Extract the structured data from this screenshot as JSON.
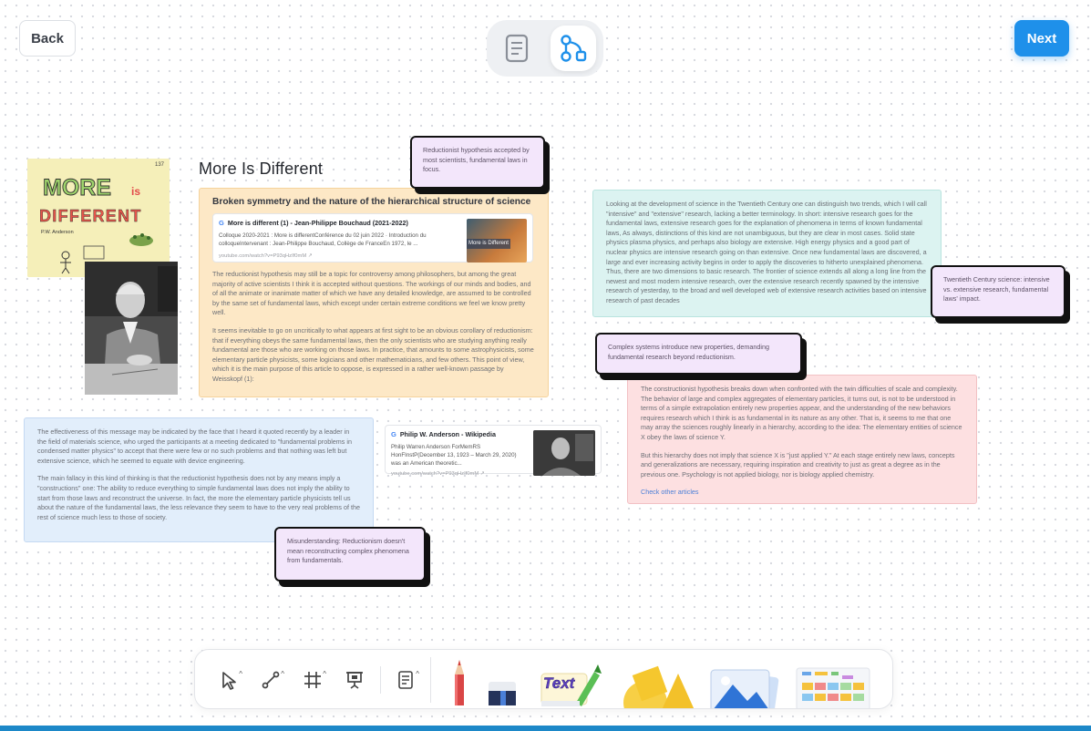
{
  "header": {
    "back_label": "Back",
    "next_label": "Next"
  },
  "page": {
    "title": "More Is Different"
  },
  "poster": {
    "line1": "MORE",
    "line1b": "is",
    "line2": "DIFFERENT",
    "author": "P.W. Anderson",
    "corner": "137"
  },
  "card_orange": {
    "heading": "Broken symmetry and the nature of the hierarchical structure of science",
    "link": {
      "title": "More is different (1) - Jean-Philippe Bouchaud (2021-2022)",
      "desc": "Colloque 2020-2021 : More is differentConférence du 02 juin 2022 · Introduction du colloqueIntervenant : Jean-Philippe Bouchaud, Collège de FranceEn 1972, le ...",
      "url": "youtube.com/watch?v=P93qHzIf0mM",
      "thumb_caption": "More is Different"
    },
    "p1": "The reductionist hypothesis may still be a topic for controversy among philosophers, but among the great majority of active scientists I think it is accepted without questions. The workings of our minds and bodies, and of all the animate or inanimate matter of which we have any detailed knowledge, are assumed to be controlled by the same set of fundamental laws, which except under certain extreme conditions we feel we know pretty well.",
    "p2": "It seems inevitable to go on uncritically to what appears at first sight to be an obvious corollary of reductionism: that if everything obeys the same fundamental laws, then the only scientists who are studying anything really fundamental are those who are working on those laws. In practice, that amounts to some astrophysicists, some elementary particle physicists, some logicians and other mathematicians, and few others. This point of view, which it is the main purpose of this article to oppose, is expressed in a rather well-known passage by Weisskopf (1):"
  },
  "card_teal": {
    "text": "Looking at the development of science in the Twentieth Century one can distinguish two trends, which I will call \"intensive\" and \"extensive\" research, lacking a better terminology. In short: intensive research goes for the fundamental laws, extensive research goes for the explanation of phenomena in terms of known fundamental laws, As always, distinctions of this kind are not unambiguous, but they are clear in most cases. Solid state physics plasma physics, and perhaps also biology are extensive. High energy physics and a good part of nuclear physics are intensive research going on than extensive. Once new fundamental laws are discovered, a large and ever increasing activity begins in order to apply the discoveries to hitherto unexplained phenomena. Thus, there are two dimensions to basic research. The frontier of science extends all along a long line from the newest and most modern intensive research, over the extensive research recently spawned by the intensive research of yesterday, to the broad and well developed web of extensive research activities based on intensive research of past decades"
  },
  "card_pink": {
    "p1": "The constructionist hypothesis breaks down when confronted with the twin difficulties of scale and complexity. The behavior of large and complex aggregates of elementary particles, it turns out, is not to be understood in terms of a simple extrapolation entirely new properties appear, and the understanding of the new behaviors requires research which I think is as fundamental in its nature as any other. That is, it seems to me that one may array the sciences roughly linearly in a hierarchy, according to the idea: The elementary entities of science X obey the laws of science Y.",
    "p2": "But this hierarchy does not imply that science X is \"just applied Y.\" At each stage entirely new laws, concepts and generalizations are necessary, requiring inspiration and creativity to just as great a degree as in the previous one. Psychology is not applied biology, nor is biology applied chemistry.",
    "link_label": "Check other articles"
  },
  "card_blue": {
    "p1": "The effectiveness of this message may be indicated by the face that I heard it quoted recently by a leader in the field of materials science, who urged the participants at a meeting dedicated to \"fundamental problems in condensed matter physics\" to accept that there were few or no such problems and that nothing was left but extensive science, which he seemed to equate with device engineering.",
    "p2": "The main fallacy in this kind of thinking is that the reductionist hypothesis does not by any means imply a \"constructions\" one: The ability to reduce everything to simple fundamental laws does not imply the ability to start from those laws and reconstruct the universe. In fact, the more the elementary particle physicists tell us about the nature of the fundamental laws, the less relevance they seem to have to the very real problems of the rest of science much less to those of society."
  },
  "link_wiki": {
    "title": "Philip W. Anderson - Wikipedia",
    "desc": "Philip Warren Anderson ForMemRS HonFInstP(December 13, 1923 – March 29, 2020) was an American theoretic...",
    "url": "youtube.com/watch?v=P93qHzIf0mM"
  },
  "stickies": {
    "s1": "Reductionist hypothesis accepted by most scientists, fundamental laws in focus.",
    "s2": "Twentieth Century science: intensive vs. extensive research, fundamental laws' impact.",
    "s3": "Complex systems introduce new properties, demanding fundamental research beyond reductionism.",
    "s4": "Misunderstanding: Reductionism doesn't mean reconstructing complex phenomena from fundamentals."
  },
  "toolbar": {
    "text_tool_label": "Text"
  },
  "colors": {
    "accent": "#1e90ea",
    "sticky_bg": "#f3e6fb",
    "card_orange": "#fde8c6",
    "card_teal": "#dcf3f1",
    "card_pink": "#fde0e1",
    "card_blue": "#e2eefb"
  },
  "icons": {
    "doc_view": "document-icon",
    "graph_view": "flow-graph-icon",
    "select": "cursor-icon",
    "connector": "connector-icon",
    "frame": "frame-icon",
    "present": "presentation-icon",
    "note": "note-icon",
    "pen": "pen-icon",
    "eraser": "eraser-icon",
    "text": "text-tool-icon",
    "shapes": "shapes-icon",
    "image": "image-icon",
    "templates": "templates-icon"
  }
}
